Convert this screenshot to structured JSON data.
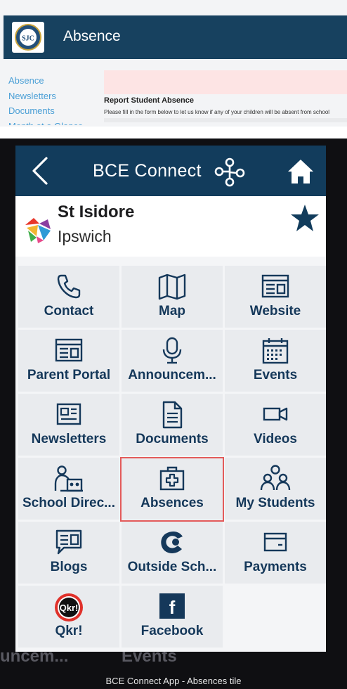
{
  "website": {
    "title": "Absence",
    "logo_text": "SJC",
    "nav": [
      "Absence",
      "Newsletters",
      "Documents",
      "Month at a Glance"
    ],
    "form_heading": "Report Student Absence",
    "form_instructions": "Please fill in the form below to let us know if any of your children will be absent from school"
  },
  "app": {
    "title": "BCE Connect",
    "school": {
      "name": "St Isidore",
      "location": "Ipswich"
    },
    "tiles": [
      {
        "label": "Contact",
        "icon": "phone-icon"
      },
      {
        "label": "Map",
        "icon": "map-icon"
      },
      {
        "label": "Website",
        "icon": "website-icon"
      },
      {
        "label": "Parent Portal",
        "icon": "parent-portal-icon"
      },
      {
        "label": "Announcem...",
        "icon": "microphone-icon"
      },
      {
        "label": "Events",
        "icon": "calendar-icon"
      },
      {
        "label": "Newsletters",
        "icon": "newsletter-icon"
      },
      {
        "label": "Documents",
        "icon": "document-icon"
      },
      {
        "label": "Videos",
        "icon": "video-camera-icon"
      },
      {
        "label": "School Direc...",
        "icon": "school-directory-icon"
      },
      {
        "label": "Absences",
        "icon": "first-aid-kit-icon",
        "highlighted": true
      },
      {
        "label": "My Students",
        "icon": "students-icon"
      },
      {
        "label": "Blogs",
        "icon": "chat-bubble-icon"
      },
      {
        "label": "Outside Sch...",
        "icon": "outside-school-icon"
      },
      {
        "label": "Payments",
        "icon": "wallet-icon"
      },
      {
        "label": "Qkr!",
        "icon": "qkr-logo",
        "logo_text": "Qkr!"
      },
      {
        "label": "Facebook",
        "icon": "facebook-icon",
        "logo_text": "f"
      }
    ]
  },
  "background_fragments": [
    "uncem...",
    "Events"
  ],
  "caption": "BCE Connect App - Absences tile",
  "colors": {
    "app_bar": "#123c5c",
    "tile_label": "#15385a",
    "tile_background": "#e9ebee",
    "highlight_border": "#e35a5a",
    "web_header": "#17415f",
    "web_link": "#4a9fd6"
  }
}
